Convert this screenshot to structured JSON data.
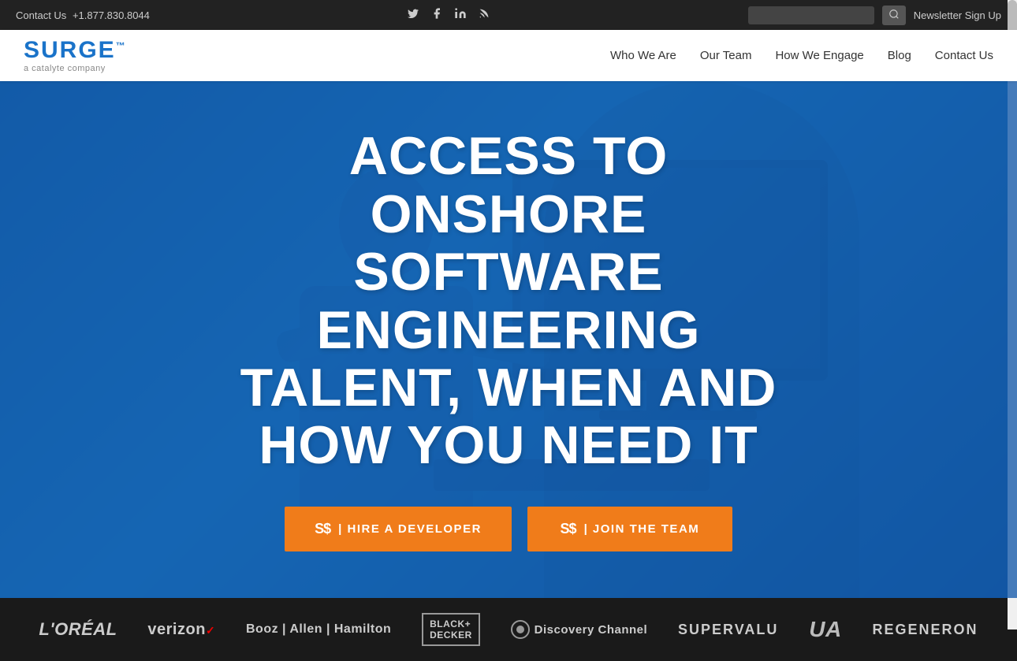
{
  "topbar": {
    "contact_label": "Contact Us",
    "phone": "+1.877.830.8044",
    "newsletter_label": "Newsletter Sign Up",
    "search_placeholder": ""
  },
  "social": {
    "twitter": "𝕏",
    "facebook": "f",
    "linkedin": "in",
    "rss": "RSS"
  },
  "nav": {
    "logo_text": "SURGE",
    "logo_sup": "™",
    "logo_sub": "a catalyte company",
    "items": [
      {
        "label": "Who We Are",
        "id": "who-we-are"
      },
      {
        "label": "Our Team",
        "id": "our-team"
      },
      {
        "label": "How We Engage",
        "id": "how-we-engage"
      },
      {
        "label": "Blog",
        "id": "blog"
      },
      {
        "label": "Contact Us",
        "id": "contact-us"
      }
    ]
  },
  "hero": {
    "title": "ACCESS TO ONSHORE SOFTWARE ENGINEERING TALENT, WHEN AND HOW YOU NEED IT",
    "btn_hire_label": "| HIRE A DEVELOPER",
    "btn_join_label": "| JOIN THE TEAM",
    "btn_icon": "S$"
  },
  "clients": {
    "items": [
      {
        "label": "L'ORÉAL",
        "class": "loreal"
      },
      {
        "label": "verizon✓",
        "class": "verizon"
      },
      {
        "label": "Booz | Allen | Hamilton",
        "class": "booz"
      },
      {
        "label": "BLACK+DECKER",
        "class": "bd"
      },
      {
        "label": "Discovery Channel",
        "class": "discovery"
      },
      {
        "label": "SUPERVALU",
        "class": "supervalu"
      },
      {
        "label": "UA",
        "class": "ua"
      },
      {
        "label": "REGENERON",
        "class": "regen"
      }
    ]
  }
}
